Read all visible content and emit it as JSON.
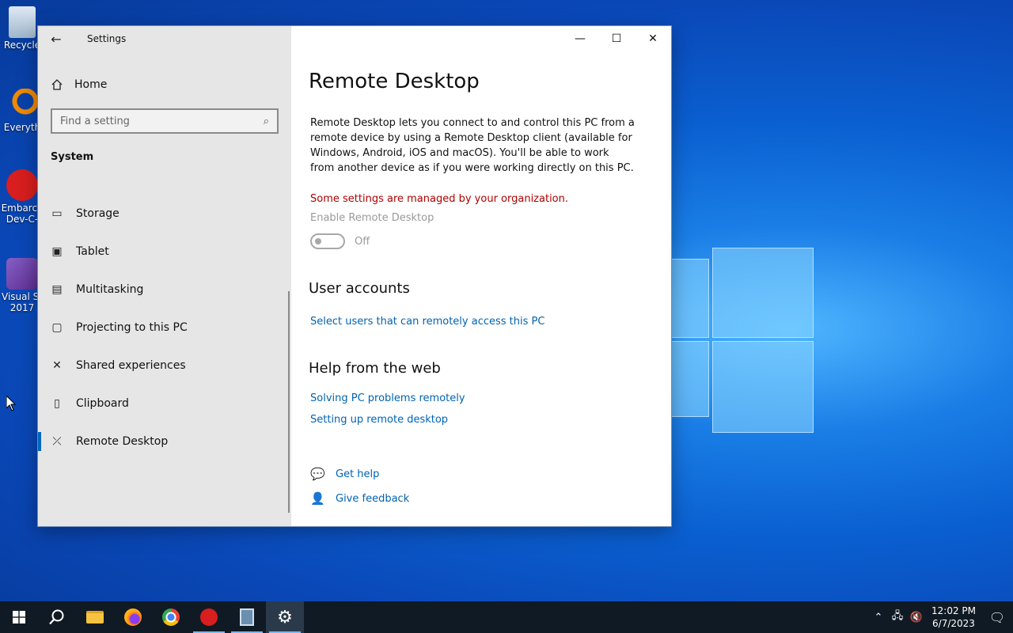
{
  "desktop": {
    "icons": [
      {
        "label": "Recycle",
        "icon": "recycle-bin-icon"
      },
      {
        "label": "Everyth",
        "icon": "everything-search-icon"
      },
      {
        "label": "Embarca\nDev-C",
        "label1": "Embarca",
        "label2": "Dev-C-",
        "icon": "devcpp-icon"
      },
      {
        "label1": "Visual St",
        "label2": "2017",
        "icon": "visual-studio-icon"
      }
    ]
  },
  "window": {
    "app_title": "Settings",
    "controls": {
      "minimize": "—",
      "maximize": "☐",
      "close": "✕"
    }
  },
  "sidebar": {
    "home_label": "Home",
    "search_placeholder": "Find a setting",
    "section_title": "System",
    "items": [
      {
        "label": "Storage",
        "icon": "storage-icon"
      },
      {
        "label": "Tablet",
        "icon": "tablet-icon"
      },
      {
        "label": "Multitasking",
        "icon": "multitasking-icon"
      },
      {
        "label": "Projecting to this PC",
        "icon": "projecting-icon"
      },
      {
        "label": "Shared experiences",
        "icon": "shared-experiences-icon"
      },
      {
        "label": "Clipboard",
        "icon": "clipboard-icon"
      },
      {
        "label": "Remote Desktop",
        "icon": "remote-desktop-icon",
        "active": true
      }
    ]
  },
  "content": {
    "title": "Remote Desktop",
    "description": "Remote Desktop lets you connect to and control this PC from a remote device by using a Remote Desktop client (available for Windows, Android, iOS and macOS). You'll be able to work from another device as if you were working directly on this PC.",
    "managed_notice": "Some settings are managed by your organization.",
    "toggle_label": "Enable Remote Desktop",
    "toggle_state": "Off",
    "user_accounts_heading": "User accounts",
    "user_accounts_link": "Select users that can remotely access this PC",
    "help_heading": "Help from the web",
    "help_links": [
      "Solving PC problems remotely",
      "Setting up remote desktop"
    ],
    "get_help": "Get help",
    "give_feedback": "Give feedback"
  },
  "taskbar": {
    "clock_time": "12:02 PM",
    "clock_date": "6/7/2023"
  },
  "colors": {
    "accent": "#0067c0",
    "link": "#0063b1",
    "warning": "#b00000",
    "taskbar": "#101a24"
  }
}
